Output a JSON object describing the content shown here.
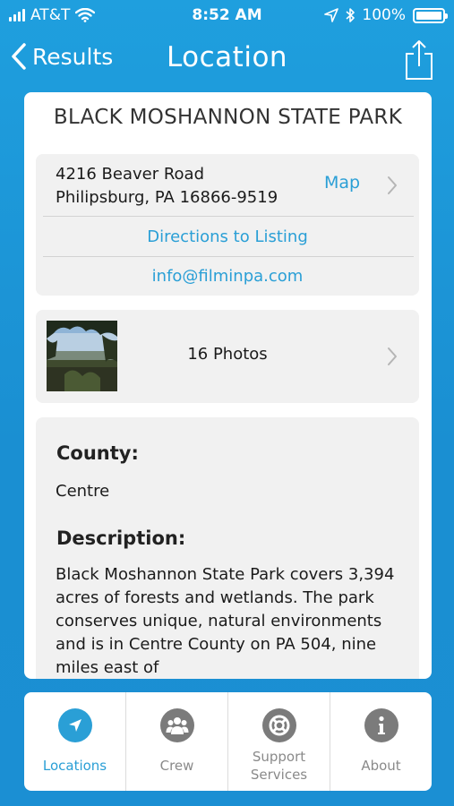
{
  "status_bar": {
    "carrier": "AT&T",
    "time": "8:52 AM",
    "battery": "100%"
  },
  "nav": {
    "back_label": "Results",
    "title": "Location"
  },
  "place": {
    "name": "BLACK MOSHANNON STATE PARK",
    "address_line1": "4216 Beaver Road",
    "address_line2": "Philipsburg, PA 16866-9519",
    "map_label": "Map",
    "directions_label": "Directions to Listing",
    "email": "info@filminpa.com",
    "photos_label": "16 Photos",
    "county_heading": "County:",
    "county_value": "Centre",
    "description_heading": "Description:",
    "description": "Black Moshannon State Park covers 3,394 acres of forests and wetlands. The park conserves unique, natural environments and is in Centre County on PA 504, nine miles east of"
  },
  "tabs": [
    {
      "label": "Locations",
      "icon": "location-arrow-icon",
      "active": true
    },
    {
      "label": "Crew",
      "icon": "people-icon",
      "active": false
    },
    {
      "label": "Support Services",
      "icon": "lifebuoy-icon",
      "active": false
    },
    {
      "label": "About",
      "icon": "info-icon",
      "active": false
    }
  ],
  "colors": {
    "accent": "#2a9fd6",
    "background": "#1f9fde",
    "card": "#ffffff",
    "panel": "#f1f1f1"
  }
}
